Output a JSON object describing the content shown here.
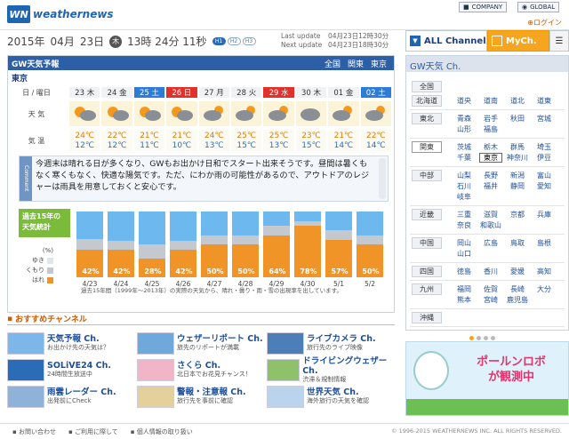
{
  "header": {
    "logo_mark": "WN",
    "logo_text": "weathernews",
    "company": "COMPANY",
    "global": "GLOBAL",
    "login": "ログイン"
  },
  "datetime": {
    "year": "2015年",
    "month": "04月",
    "day": "23日",
    "weekday": "木",
    "time": "13時 24分 11秒",
    "h1": "H1",
    "h2": "H2",
    "h3": "H3"
  },
  "update": {
    "last_label": "Last update",
    "last_value": "04月23日12時30分",
    "next_label": "Next update",
    "next_value": "04月23日18時30分"
  },
  "channels": {
    "all": "ALL Channel",
    "my": "MyCh."
  },
  "forecast": {
    "title": "GW天気予報",
    "crumbs": [
      "全国",
      "関東",
      "東京"
    ],
    "city": "東京",
    "row_labels": {
      "date": "日 / 曜日",
      "weather": "天 気",
      "temp": "気 温"
    },
    "days": [
      {
        "label": "23 木",
        "type": "",
        "icon": "sun-cloud",
        "hi": "24℃",
        "lo": "12℃"
      },
      {
        "label": "24 金",
        "type": "",
        "icon": "sun-cloud",
        "hi": "22℃",
        "lo": "12℃"
      },
      {
        "label": "25 土",
        "type": "sat",
        "icon": "sun-cloud",
        "hi": "21℃",
        "lo": "11℃"
      },
      {
        "label": "26 日",
        "type": "sun",
        "icon": "sun-cloud",
        "hi": "21℃",
        "lo": "10℃"
      },
      {
        "label": "27 月",
        "type": "",
        "icon": "cloud-sun",
        "hi": "24℃",
        "lo": "13℃"
      },
      {
        "label": "28 火",
        "type": "",
        "icon": "cloud-sun",
        "hi": "25℃",
        "lo": "15℃"
      },
      {
        "label": "29 水",
        "type": "sun",
        "icon": "cloud-sun",
        "hi": "25℃",
        "lo": "13℃"
      },
      {
        "label": "30 木",
        "type": "",
        "icon": "cloud",
        "hi": "23℃",
        "lo": "15℃"
      },
      {
        "label": "01 金",
        "type": "",
        "icon": "cloud-sun",
        "hi": "21℃",
        "lo": "14℃"
      },
      {
        "label": "02 土",
        "type": "sat",
        "icon": "cloud-sun",
        "hi": "22℃",
        "lo": "14℃"
      }
    ],
    "comment_tab": "Comment",
    "comment": "今週末は晴れる日が多くなり、GWもお出かけ日和でスタート出来そうです。昼間は暑くもなく寒くもなく、快適な陽気です。ただ、にわか雨の可能性があるので、アウトドアのレジャーは雨具を用意しておくと安心です。"
  },
  "stats": {
    "label": "過去15年の天気統計",
    "legend_unit": "(%)",
    "legend": [
      "ゆき",
      "くもり",
      "はれ"
    ],
    "footnote": "過去15年間（1999年〜2013年）の実際の天気から、晴れ・曇り・雨・雪の出現率を出しています。",
    "colors": {
      "snow": "#dfe6ee",
      "rain": "#6db8ee",
      "cloud": "#c4c9cf",
      "sun": "#f09428"
    }
  },
  "chart_data": {
    "type": "bar",
    "categories": [
      "4/23",
      "4/24",
      "4/25",
      "4/26",
      "4/27",
      "4/28",
      "4/29",
      "4/30",
      "5/1",
      "5/2"
    ],
    "series": [
      {
        "name": "はれ",
        "values": [
          42,
          42,
          28,
          42,
          50,
          50,
          64,
          78,
          57,
          50
        ]
      },
      {
        "name": "くもり",
        "values": [
          16,
          14,
          22,
          14,
          14,
          14,
          14,
          7,
          14,
          14
        ]
      },
      {
        "name": "ゆき",
        "values": [
          0,
          0,
          0,
          0,
          0,
          0,
          0,
          0,
          0,
          0
        ]
      }
    ],
    "labels": [
      "42%",
      "42%",
      "28%",
      "42%",
      "50%",
      "50%",
      "64%",
      "78%",
      "57%",
      "50%"
    ],
    "ylim": [
      0,
      100
    ]
  },
  "recommend": {
    "title": "おすすめチャンネル",
    "cards": [
      {
        "title": "天気予報 Ch.",
        "sub": "お出かけ先の天気は？"
      },
      {
        "title": "ウェザーリポート Ch.",
        "sub": "旅先のリポートが満載"
      },
      {
        "title": "ライブカメラ Ch.",
        "sub": "旅行先のライブ映像"
      },
      {
        "title": "SOLiVE24 Ch.",
        "sub": "24時間生放送中"
      },
      {
        "title": "さくら Ch.",
        "sub": "北日本でお花見チャンス！"
      },
      {
        "title": "ドライビングウェザー Ch.",
        "sub": "渋滞＆規制情報"
      },
      {
        "title": "雨雲レーダー Ch.",
        "sub": "出発前にCheck"
      },
      {
        "title": "警報・注意報 Ch.",
        "sub": "旅行先を事前に確認"
      },
      {
        "title": "世界天気 Ch.",
        "sub": "海外旅行の天気を確認"
      }
    ]
  },
  "side": {
    "title": "GW天気 Ch.",
    "top": "全国",
    "regions": [
      {
        "name": "北海道",
        "prefs": [
          "道央",
          "道南",
          "道北",
          "道東"
        ]
      },
      {
        "name": "東北",
        "prefs": [
          "青森",
          "岩手",
          "秋田",
          "宮城",
          "山形",
          "福島"
        ]
      },
      {
        "name": "関東",
        "prefs": [
          "茨城",
          "栃木",
          "群馬",
          "埼玉",
          "千葉",
          "東京",
          "神奈川",
          "伊豆"
        ]
      },
      {
        "name": "中部",
        "prefs": [
          "山梨",
          "長野",
          "新潟",
          "富山",
          "石川",
          "福井",
          "静岡",
          "愛知",
          "岐阜"
        ]
      },
      {
        "name": "近畿",
        "prefs": [
          "三重",
          "滋賀",
          "京都",
          "兵庫",
          "奈良",
          "和歌山"
        ]
      },
      {
        "name": "中国",
        "prefs": [
          "岡山",
          "広島",
          "鳥取",
          "島根",
          "山口"
        ]
      },
      {
        "name": "四国",
        "prefs": [
          "徳島",
          "香川",
          "愛媛",
          "高知"
        ]
      },
      {
        "name": "九州",
        "prefs": [
          "福岡",
          "佐賀",
          "長崎",
          "大分",
          "熊本",
          "宮崎",
          "鹿児島"
        ]
      },
      {
        "name": "沖縄",
        "prefs": []
      }
    ],
    "selected": "東京"
  },
  "ad": {
    "line1": "ポールンロボ",
    "line2": "が観測中"
  },
  "footer": {
    "links": [
      "お問い合わせ",
      "ご利用に際して",
      "個人情報の取り扱い"
    ],
    "copyright": "© 1996-2015 WEATHERNEWS INC. ALL RIGHTS RESERVED."
  }
}
